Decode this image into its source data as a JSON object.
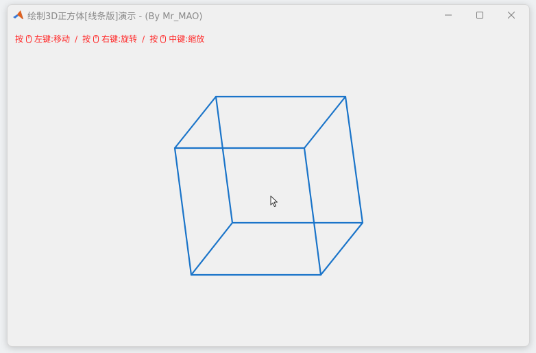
{
  "window": {
    "title": "绘制3D正方体[线条版]演示 - (By Mr_MAO)"
  },
  "hints": [
    {
      "prefix": "按",
      "action": "左键:移动"
    },
    {
      "prefix": "按",
      "action": "右键:旋转"
    },
    {
      "prefix": "按",
      "action": "中键:缩放"
    }
  ],
  "hint_separator": "/",
  "colors": {
    "hint_text": "#ff2a2a",
    "cube_edge": "#1a74c9",
    "title_text": "#8a8a8a",
    "background": "#f0f0f0"
  },
  "icons": {
    "app": "matlab-logo-icon",
    "mouse": "mouse-icon",
    "minimize": "minimize-icon",
    "maximize": "maximize-icon",
    "close": "close-icon",
    "cursor": "arrow-cursor-icon"
  }
}
